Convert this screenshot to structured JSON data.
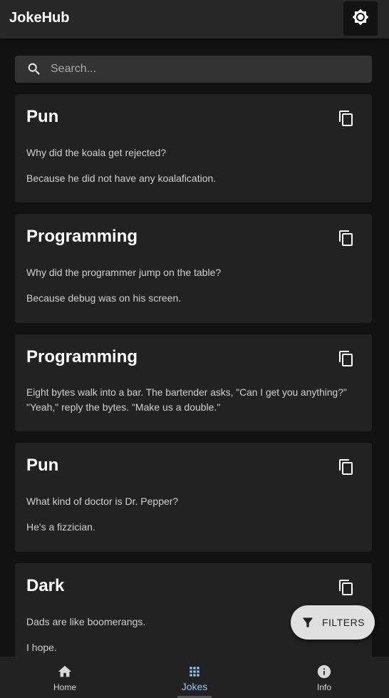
{
  "app": {
    "title": "JokeHub"
  },
  "search": {
    "placeholder": "Search..."
  },
  "jokes": [
    {
      "category": "Pun",
      "lines": [
        "Why did the koala get rejected?",
        "Because he did not have any koalafication."
      ]
    },
    {
      "category": "Programming",
      "lines": [
        "Why did the programmer jump on the table?",
        "Because debug was on his screen."
      ]
    },
    {
      "category": "Programming",
      "lines": [
        "Eight bytes walk into a bar. The bartender asks, \"Can I get you anything?\"",
        "\"Yeah,\" reply the bytes. \"Make us a double.\""
      ]
    },
    {
      "category": "Pun",
      "lines": [
        "What kind of doctor is Dr. Pepper?",
        "He's a fizzician."
      ]
    },
    {
      "category": "Dark",
      "lines": [
        "Dads are like boomerangs.",
        "I hope."
      ]
    }
  ],
  "fab": {
    "label": "FILTERS",
    "icon": "filter-icon"
  },
  "nav": {
    "items": [
      {
        "label": "Home",
        "icon": "home-icon"
      },
      {
        "label": "Jokes",
        "icon": "grid-icon",
        "active": true
      },
      {
        "label": "Info",
        "icon": "info-icon"
      }
    ]
  },
  "colors": {
    "accent": "#90caf9",
    "background": "#121212",
    "card": "#222222",
    "appbar": "#272727"
  }
}
